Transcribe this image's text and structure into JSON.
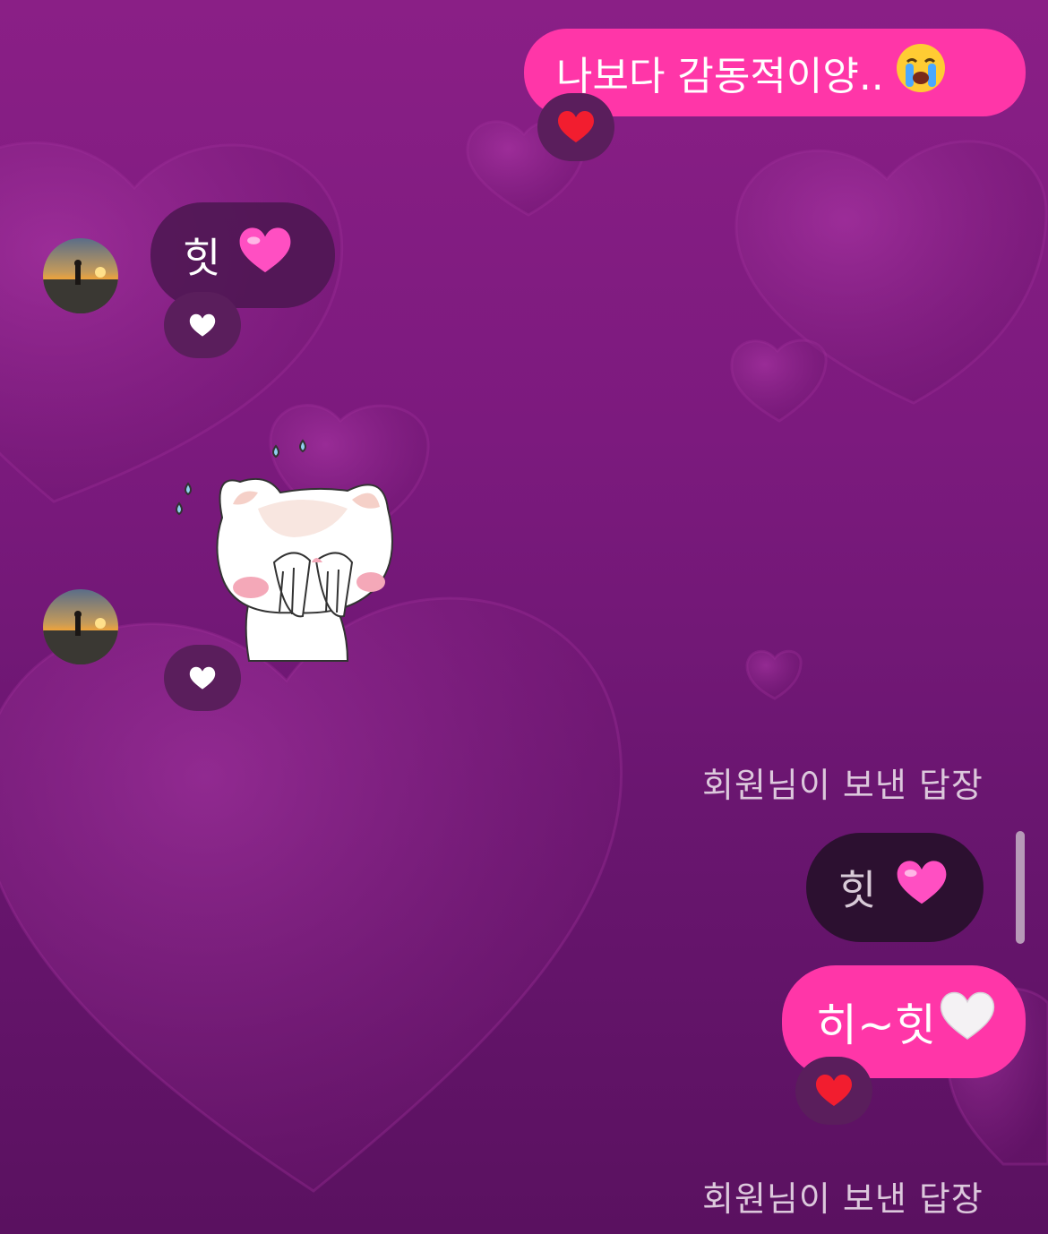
{
  "messages": [
    {
      "id": "m1",
      "side": "sent",
      "text": "나보다 감동적이양..",
      "emoji": "crying-face",
      "reaction": "red-heart"
    },
    {
      "id": "m2",
      "side": "received",
      "text": "힛",
      "emoji": "pink-heart",
      "reaction": "white-heart"
    },
    {
      "id": "m3",
      "side": "received",
      "sticker": "cat-blushing-sticker",
      "reaction": "white-heart"
    },
    {
      "id": "m4",
      "side": "sent",
      "reply_label": "회원님이 보낸 답장",
      "quoted_text": "힛",
      "quoted_emoji": "pink-heart",
      "text": "히~힛",
      "emoji": "white-heart",
      "reaction": "red-heart"
    },
    {
      "id": "m5",
      "side": "sent",
      "reply_label": "회원님이 보낸 답장"
    }
  ],
  "colors": {
    "sent_bubble": "#ff36a8",
    "received_bubble": "#4b1650",
    "quote_bubble": "#2c1030",
    "background": "#7c1a7e"
  }
}
